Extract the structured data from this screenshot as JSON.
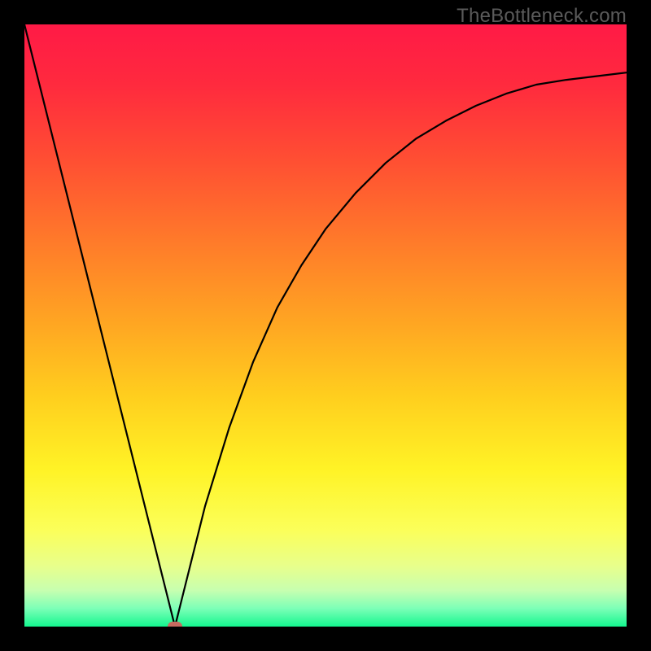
{
  "watermark": "TheBottleneck.com",
  "colors": {
    "frame": "#000000",
    "curve_stroke": "#000000",
    "marker_fill": "#c76a5f",
    "gradient_stops": [
      {
        "pct": 0,
        "color": "#ff1a46"
      },
      {
        "pct": 10,
        "color": "#ff2a3e"
      },
      {
        "pct": 22,
        "color": "#ff4d33"
      },
      {
        "pct": 36,
        "color": "#ff7a2a"
      },
      {
        "pct": 50,
        "color": "#ffa722"
      },
      {
        "pct": 62,
        "color": "#ffcf1e"
      },
      {
        "pct": 74,
        "color": "#fff326"
      },
      {
        "pct": 84,
        "color": "#fbff5a"
      },
      {
        "pct": 90,
        "color": "#e8ff8c"
      },
      {
        "pct": 94,
        "color": "#c7ffb0"
      },
      {
        "pct": 97,
        "color": "#7cffb7"
      },
      {
        "pct": 100,
        "color": "#14f78f"
      }
    ]
  },
  "chart_data": {
    "type": "line",
    "title": "",
    "xlabel": "",
    "ylabel": "",
    "xlim": [
      0,
      1
    ],
    "ylim": [
      0,
      1
    ],
    "x": [
      0.0,
      0.04,
      0.08,
      0.12,
      0.16,
      0.2,
      0.225,
      0.24,
      0.25,
      0.26,
      0.275,
      0.3,
      0.34,
      0.38,
      0.42,
      0.46,
      0.5,
      0.55,
      0.6,
      0.65,
      0.7,
      0.75,
      0.8,
      0.85,
      0.9,
      0.95,
      1.0
    ],
    "values": [
      1.0,
      0.84,
      0.68,
      0.52,
      0.36,
      0.2,
      0.1,
      0.04,
      0.0,
      0.04,
      0.1,
      0.2,
      0.33,
      0.44,
      0.53,
      0.6,
      0.66,
      0.72,
      0.77,
      0.81,
      0.84,
      0.865,
      0.885,
      0.9,
      0.908,
      0.914,
      0.92
    ],
    "min_point": {
      "x": 0.25,
      "y": 0.0
    },
    "annotations": []
  }
}
